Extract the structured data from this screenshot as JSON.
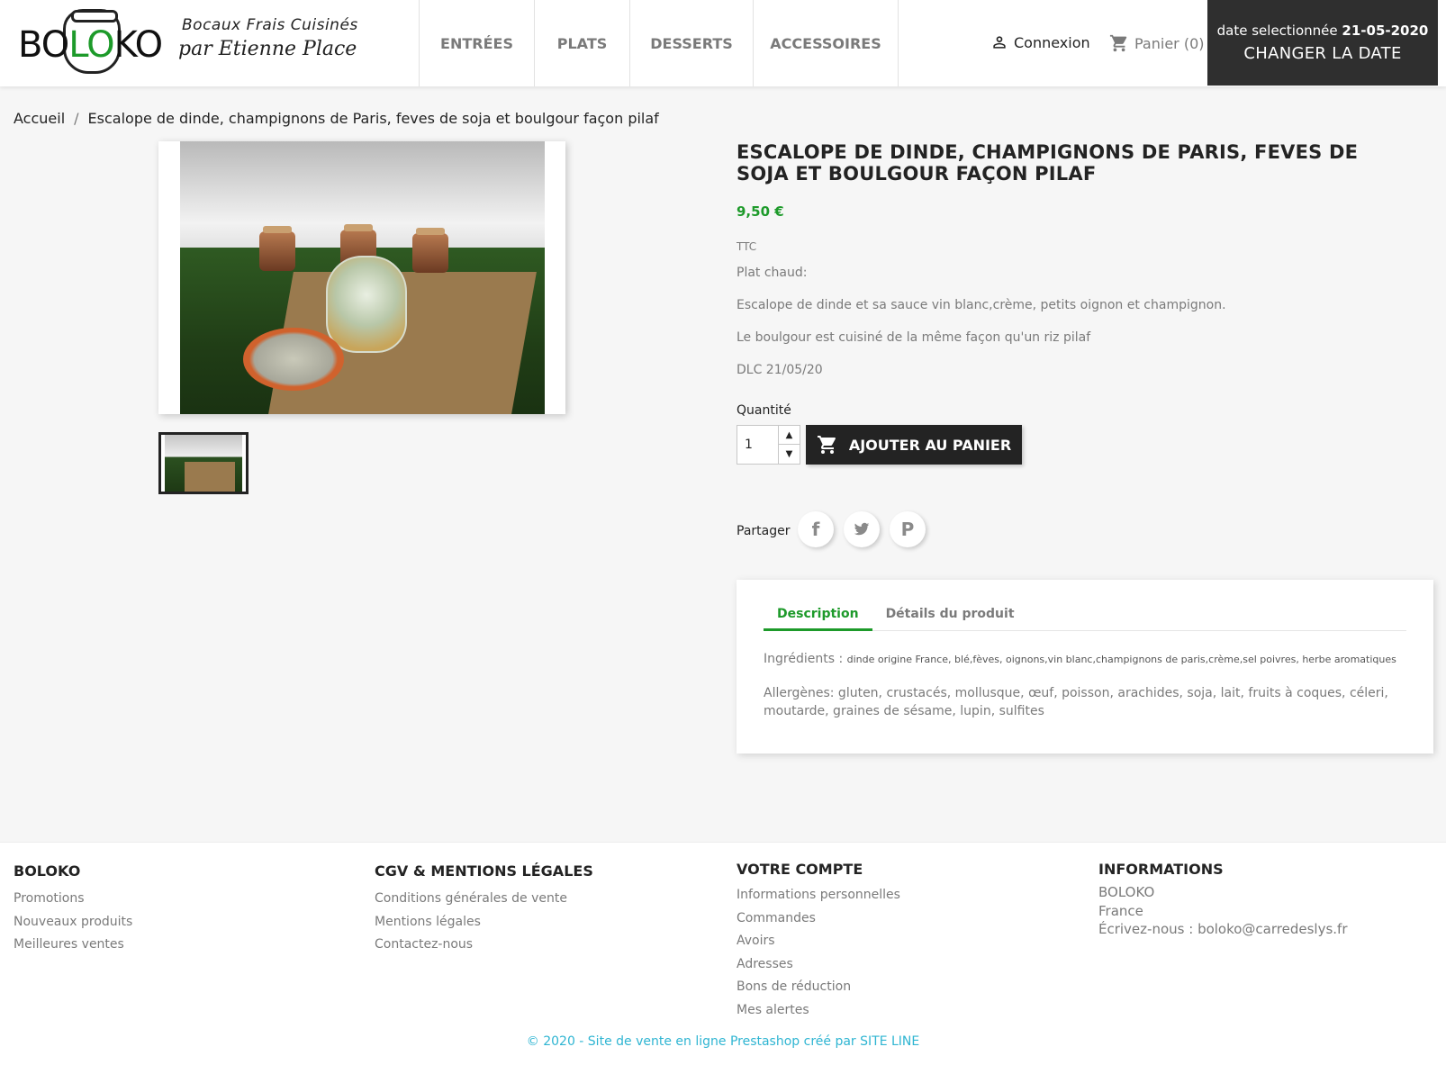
{
  "header": {
    "logo_text": "BOLOKO",
    "tagline1": "Bocaux Frais Cuisinés",
    "tagline2": "par Etienne Place",
    "nav": [
      "ENTRÉES",
      "PLATS",
      "DESSERTS",
      "ACCESSOIRES"
    ],
    "login_label": "Connexion",
    "cart_label": "Panier",
    "cart_count": "(0)",
    "date_prefix": "date selectionnée",
    "date_value": "21-05-2020",
    "change_date_label": "CHANGER LA DATE"
  },
  "breadcrumb": {
    "home": "Accueil",
    "separator": "/",
    "current": "Escalope de dinde, champignons de Paris, feves de soja et boulgour façon pilaf"
  },
  "product": {
    "title": "Escalope de dinde, champignons de Paris, feves de soja et boulgour façon pilaf",
    "price": "9,50 €",
    "tax_label": "TTC",
    "description": [
      "Plat chaud:",
      "Escalope de dinde et sa sauce vin blanc,crème, petits oignon et champignon.",
      "Le boulgour est cuisiné de la même façon qu'un riz pilaf",
      "DLC 21/05/20"
    ],
    "quantity_label": "Quantité",
    "quantity_value": "1",
    "add_to_cart_label": "AJOUTER AU PANIER",
    "share_label": "Partager",
    "share_icons": [
      "facebook-icon",
      "twitter-icon",
      "pinterest-icon"
    ]
  },
  "tabs": {
    "items": [
      "Description",
      "Détails du produit"
    ],
    "active": "Description",
    "ingredients_label": "Ingrédients :",
    "ingredients_value": "dinde origine France, blé,fèves,  oignons,vin blanc,champignons de paris,crème,sel poivres, herbe aromatiques",
    "allergens": "Allergènes: gluten, crustacés, mollusque, œuf, poisson, arachides, soja, lait, fruits à coques, céleri, moutarde, graines de sésame, lupin, sulfites"
  },
  "footer": {
    "col1": {
      "title": "BOLOKO",
      "links": [
        "Promotions",
        "Nouveaux produits",
        "Meilleures ventes"
      ]
    },
    "col2": {
      "title": "CGV & Mentions légales",
      "links": [
        "Conditions générales de vente",
        "Mentions légales",
        "Contactez-nous"
      ]
    },
    "col3": {
      "title": "Votre compte",
      "links": [
        "Informations personnelles",
        "Commandes",
        "Avoirs",
        "Adresses",
        "Bons de réduction",
        "Mes alertes"
      ]
    },
    "col4": {
      "title": "Informations",
      "lines": [
        "BOLOKO",
        "France"
      ],
      "email_prefix": "Écrivez-nous :",
      "email": "boloko@carredeslys.fr"
    },
    "copyright": "© 2020 - Site de vente en ligne Prestashop créé par SITE LINE"
  },
  "colors": {
    "accent_green": "#1d9a2a",
    "dark": "#232323",
    "date_box_bg": "#2f2f2f",
    "link_blue": "#2fb5d2"
  }
}
